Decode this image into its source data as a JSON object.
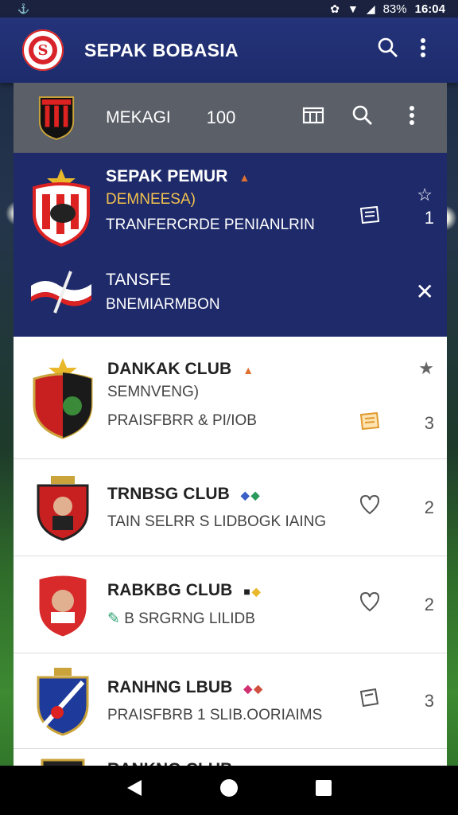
{
  "status_bar": {
    "battery": "83%",
    "time": "16:04"
  },
  "app_bar": {
    "title": "SEPAK BOBASIA"
  },
  "sub_bar": {
    "name": "MEKAGI",
    "count": "100"
  },
  "featured": {
    "title": "SEPAK PEMUR",
    "subtitle": "DEMNEESA)",
    "description": "TRANFERCRDE PENIANLRIN",
    "count": "1",
    "secondary_title": "TANSFE",
    "secondary_subtitle": "BNEMIARMBON"
  },
  "items": [
    {
      "title": "DANKAK CLUB",
      "subtitle": "SEMNVENG)",
      "description": "PRAISFBRR & PI/IOB",
      "count": "3",
      "icon": "document-icon"
    },
    {
      "title": "TRNBSG CLUB",
      "subtitle": "",
      "description": "TAIN SELRR S LIDBOGK IAING",
      "count": "2",
      "icon": "heart-icon"
    },
    {
      "title": "RABKBG CLUB",
      "subtitle": "",
      "description": "B SRGRNG LILIDB",
      "count": "2",
      "icon": "heart-icon"
    },
    {
      "title": "RANHNG LBUB",
      "subtitle": "",
      "description": "PRAISFBRB 1 SLIB.OORIAIMS",
      "count": "3",
      "icon": "document-icon"
    },
    {
      "title": "RANKNG CLUB",
      "subtitle": "",
      "description": "",
      "count": "",
      "icon": ""
    }
  ],
  "colors": {
    "primary": "#24337a",
    "accent": "#f2c14e",
    "sub_bar": "#5a5f68"
  }
}
